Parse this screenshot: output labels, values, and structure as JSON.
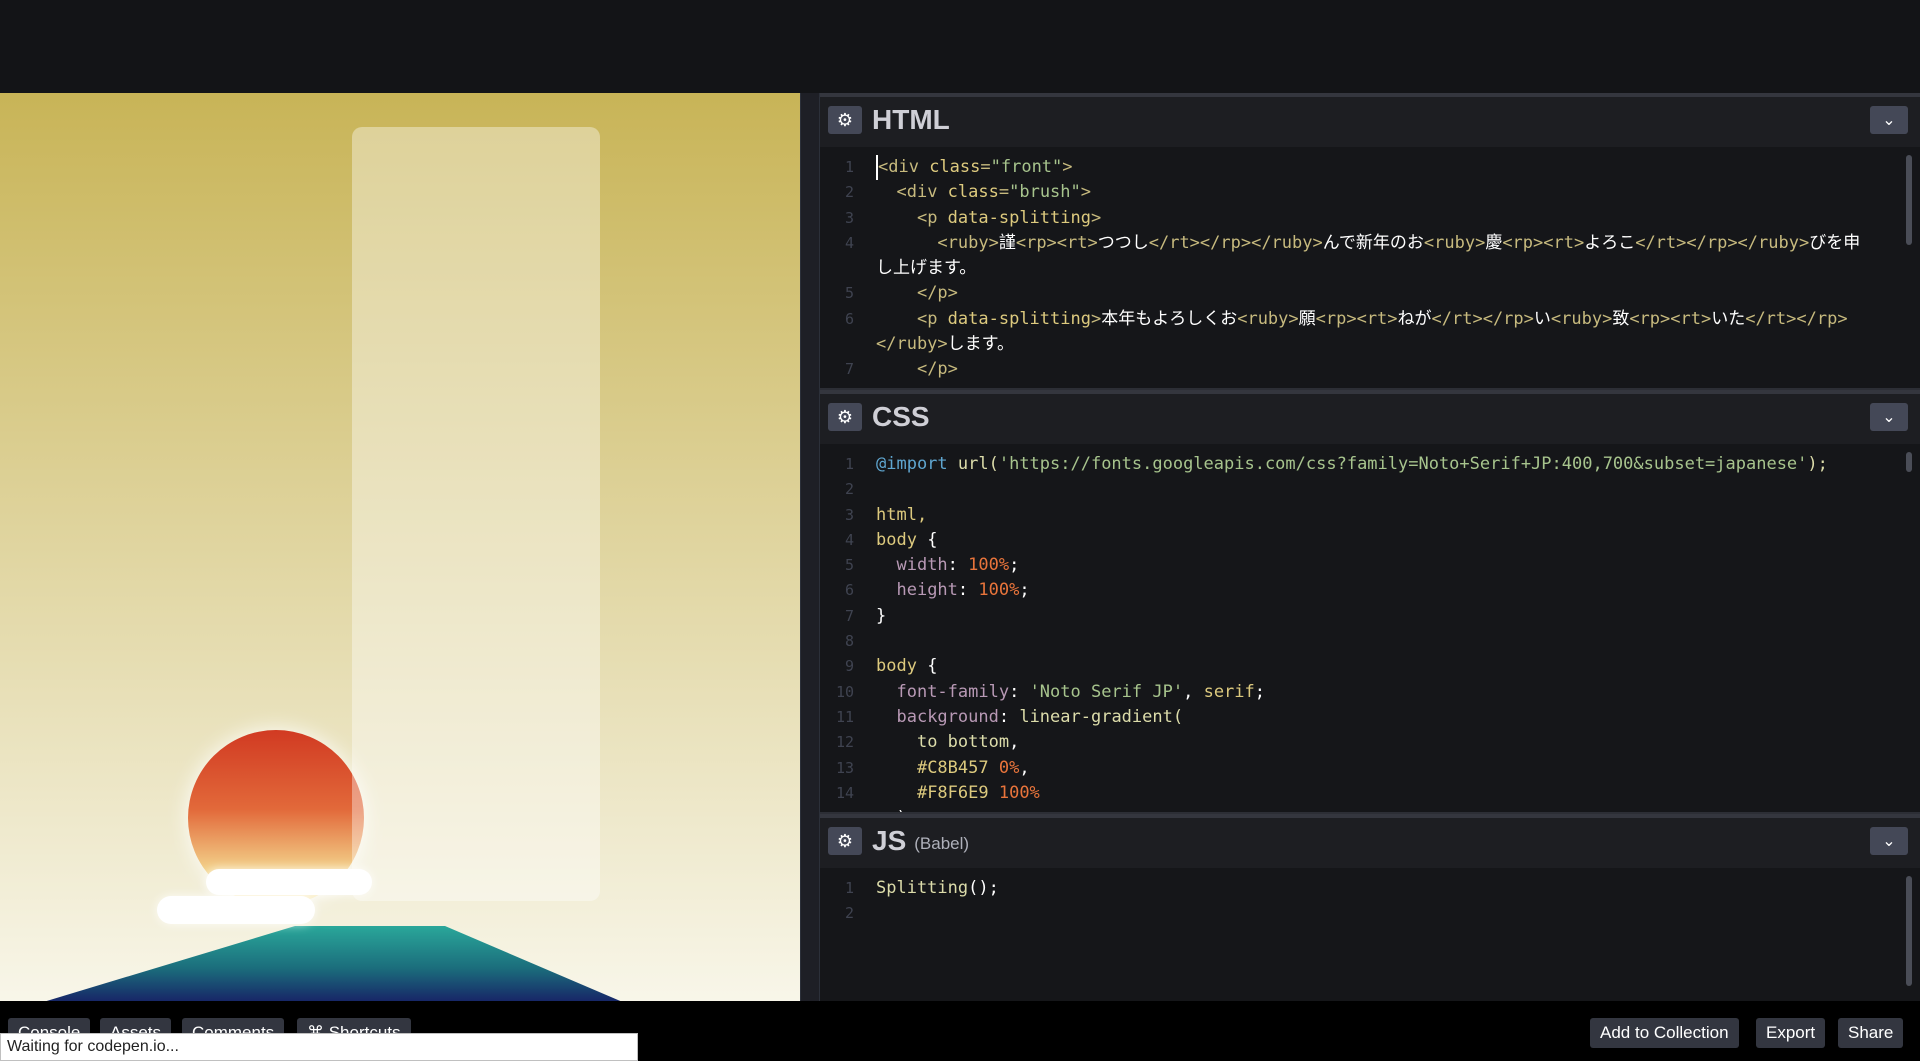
{
  "editors": {
    "html": {
      "title": "HTML",
      "lines": [
        {
          "n": "1",
          "parts": [
            [
              "tag",
              "<div "
            ],
            [
              "attr",
              "class"
            ],
            [
              "tag",
              "="
            ],
            [
              "str",
              "\"front\""
            ],
            [
              "tag",
              ">"
            ]
          ]
        },
        {
          "n": "2",
          "parts": [
            [
              "txt",
              "  "
            ],
            [
              "tag",
              "<div "
            ],
            [
              "attr",
              "class"
            ],
            [
              "tag",
              "="
            ],
            [
              "str",
              "\"brush\""
            ],
            [
              "tag",
              ">"
            ]
          ]
        },
        {
          "n": "3",
          "parts": [
            [
              "txt",
              "    "
            ],
            [
              "tag",
              "<p "
            ],
            [
              "attr",
              "data-splitting"
            ],
            [
              "tag",
              ">"
            ]
          ]
        },
        {
          "n": "4",
          "parts": [
            [
              "txt",
              "      "
            ],
            [
              "tag",
              "<ruby>"
            ],
            [
              "txt",
              "謹"
            ],
            [
              "tag",
              "<rp><rt>"
            ],
            [
              "txt",
              "つつし"
            ],
            [
              "tag",
              "</rt></rp></ruby>"
            ],
            [
              "txt",
              "んで新年のお"
            ],
            [
              "tag",
              "<ruby>"
            ],
            [
              "txt",
              "慶"
            ],
            [
              "tag",
              "<rp><rt>"
            ],
            [
              "txt",
              "よろこ"
            ],
            [
              "tag",
              "</rt></rp></ruby>"
            ],
            [
              "txt",
              "びを申"
            ]
          ]
        },
        {
          "n": "",
          "parts": [
            [
              "txt",
              "し上げます。"
            ]
          ]
        },
        {
          "n": "5",
          "parts": [
            [
              "txt",
              "    "
            ],
            [
              "tag",
              "</p>"
            ]
          ]
        },
        {
          "n": "6",
          "parts": [
            [
              "txt",
              "    "
            ],
            [
              "tag",
              "<p "
            ],
            [
              "attr",
              "data-splitting"
            ],
            [
              "tag",
              ">"
            ],
            [
              "txt",
              "本年もよろしくお"
            ],
            [
              "tag",
              "<ruby>"
            ],
            [
              "txt",
              "願"
            ],
            [
              "tag",
              "<rp><rt>"
            ],
            [
              "txt",
              "ねが"
            ],
            [
              "tag",
              "</rt></rp>"
            ],
            [
              "txt",
              "い"
            ],
            [
              "tag",
              "<ruby>"
            ],
            [
              "txt",
              "致"
            ],
            [
              "tag",
              "<rp><rt>"
            ],
            [
              "txt",
              "いた"
            ],
            [
              "tag",
              "</rt></rp>"
            ]
          ]
        },
        {
          "n": "",
          "parts": [
            [
              "tag",
              "</ruby>"
            ],
            [
              "txt",
              "します。"
            ]
          ]
        },
        {
          "n": "7",
          "parts": [
            [
              "txt",
              "    "
            ],
            [
              "tag",
              "</p>"
            ]
          ]
        }
      ]
    },
    "css": {
      "title": "CSS",
      "lines": [
        {
          "n": "1",
          "parts": [
            [
              "kw",
              "@import "
            ],
            [
              "fn",
              "url("
            ],
            [
              "str",
              "'https://fonts.googleapis.com/css?family=Noto+Serif+JP:400,700&subset=japanese'"
            ],
            [
              "fn",
              ");"
            ]
          ]
        },
        {
          "n": "2",
          "parts": [
            [
              "txt",
              ""
            ]
          ]
        },
        {
          "n": "3",
          "parts": [
            [
              "sel",
              "html,"
            ]
          ]
        },
        {
          "n": "4",
          "parts": [
            [
              "sel",
              "body "
            ],
            [
              "txt",
              "{"
            ]
          ]
        },
        {
          "n": "5",
          "parts": [
            [
              "txt",
              "  "
            ],
            [
              "prop",
              "width"
            ],
            [
              "txt",
              ": "
            ],
            [
              "num",
              "100%"
            ],
            [
              "txt",
              ";"
            ]
          ]
        },
        {
          "n": "6",
          "parts": [
            [
              "txt",
              "  "
            ],
            [
              "prop",
              "height"
            ],
            [
              "txt",
              ": "
            ],
            [
              "num",
              "100%"
            ],
            [
              "txt",
              ";"
            ]
          ]
        },
        {
          "n": "7",
          "parts": [
            [
              "txt",
              "}"
            ]
          ]
        },
        {
          "n": "8",
          "parts": [
            [
              "txt",
              ""
            ]
          ]
        },
        {
          "n": "9",
          "parts": [
            [
              "sel",
              "body "
            ],
            [
              "txt",
              "{"
            ]
          ]
        },
        {
          "n": "10",
          "parts": [
            [
              "txt",
              "  "
            ],
            [
              "prop",
              "font-family"
            ],
            [
              "txt",
              ": "
            ],
            [
              "str",
              "'Noto Serif JP'"
            ],
            [
              "txt",
              ", "
            ],
            [
              "sel",
              "serif"
            ],
            [
              "txt",
              ";"
            ]
          ]
        },
        {
          "n": "11",
          "parts": [
            [
              "txt",
              "  "
            ],
            [
              "prop",
              "background"
            ],
            [
              "txt",
              ": "
            ],
            [
              "fn",
              "linear-gradient("
            ]
          ]
        },
        {
          "n": "12",
          "parts": [
            [
              "txt",
              "    "
            ],
            [
              "fn",
              "to bottom"
            ],
            [
              "txt",
              ","
            ]
          ]
        },
        {
          "n": "13",
          "parts": [
            [
              "txt",
              "    "
            ],
            [
              "sel",
              "#C8B457 "
            ],
            [
              "num",
              "0%"
            ],
            [
              "txt",
              ","
            ]
          ]
        },
        {
          "n": "14",
          "parts": [
            [
              "txt",
              "    "
            ],
            [
              "sel",
              "#F8F6E9 "
            ],
            [
              "num",
              "100%"
            ]
          ]
        },
        {
          "n": "15",
          "parts": [
            [
              "txt",
              "  );"
            ]
          ]
        }
      ]
    },
    "js": {
      "title": "JS",
      "subtitle": "(Babel)",
      "lines": [
        {
          "n": "1",
          "parts": [
            [
              "fn",
              "Splitting"
            ],
            [
              "txt",
              "();"
            ]
          ]
        },
        {
          "n": "2",
          "parts": [
            [
              "txt",
              ""
            ]
          ]
        }
      ]
    }
  },
  "bottom": {
    "console": "Console",
    "assets": "Assets",
    "comments": "Comments",
    "shortcuts": "⌘ Shortcuts",
    "add_to_collection": "Add to Collection",
    "export": "Export",
    "share": "Share",
    "status": "Waiting for codepen.io..."
  },
  "icons": {
    "gear": "gear-icon",
    "collapse": "chevron-down-icon"
  },
  "colors": {
    "bg_top": "#C8B457",
    "bg_bottom": "#F8F6E9",
    "sun": "#d13a22",
    "mountain_top": "#2aa79a",
    "mountain_base": "#172266"
  }
}
